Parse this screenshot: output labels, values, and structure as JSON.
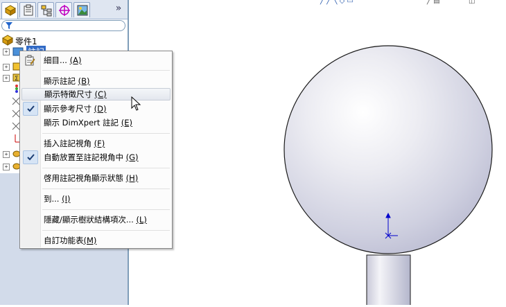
{
  "tree": {
    "root_label": "零件1",
    "annotation_label": "註記"
  },
  "menu": {
    "items": [
      {
        "id": "details",
        "label": "細目... ",
        "accel": "(A)",
        "checked": false,
        "icon": "properties-icon"
      },
      {
        "id": "show-annotations",
        "label": "顯示註記 ",
        "accel": "(B)",
        "checked": false
      },
      {
        "id": "show-feature-dims",
        "label": "顯示特徵尺寸 ",
        "accel": "(C)",
        "checked": false,
        "hover": true
      },
      {
        "id": "show-ref-dims",
        "label": "顯示參考尺寸 ",
        "accel": "(D)",
        "checked": true
      },
      {
        "id": "show-dimxpert",
        "label": "顯示 DimXpert 註記 ",
        "accel": "(E)",
        "checked": false
      },
      {
        "id": "insert-annot-view",
        "label": "插入註記視角 ",
        "accel": "(F)",
        "checked": false
      },
      {
        "id": "auto-place",
        "label": "自動放置至註記視角中 ",
        "accel": "(G)",
        "checked": true
      },
      {
        "id": "enable-display-states",
        "label": "啓用註記視角顯示狀態 ",
        "accel": "(H)",
        "checked": false
      },
      {
        "id": "goto",
        "label": "到... ",
        "accel": "(I)",
        "checked": false
      },
      {
        "id": "hide-show-tree",
        "label": "隱藏/顯示樹狀結構項次... ",
        "accel": "(L)",
        "checked": false
      },
      {
        "id": "customize-menu",
        "label": "自訂功能表",
        "accel": "(M)",
        "checked": false
      }
    ]
  },
  "colors": {
    "panel_bg": "#d2dbea",
    "sphere_edge": "#1a1a1a",
    "axis_blue": "#0000cc",
    "menu_check_bg": "#d6e4f5"
  }
}
